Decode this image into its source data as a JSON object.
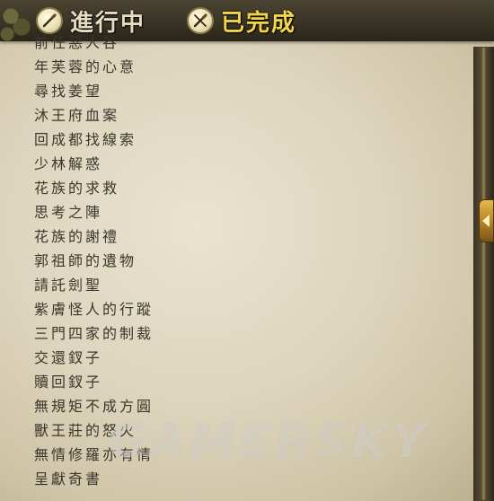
{
  "tabs": {
    "in_progress": {
      "label": "進行中",
      "icon": "brush-icon"
    },
    "completed": {
      "label": "已完成",
      "icon": "brush-crossed-icon"
    }
  },
  "quests": [
    "前任惡人谷",
    "年芙蓉的心意",
    "尋找姜望",
    "沐王府血案",
    "回成都找線索",
    "少林解惑",
    "花族的求救",
    "思考之陣",
    "花族的謝禮",
    "郭祖師的遺物",
    "請託劍聖",
    "紫膚怪人的行蹤",
    "三門四家的制裁",
    "交還釵子",
    "贖回釵子",
    "無規矩不成方圓",
    "獸王莊的怒火",
    "無情修羅亦有情",
    "呈獻奇書"
  ],
  "watermark": "GAMERSKY",
  "colors": {
    "active_tab": "#f2d64a",
    "inactive_tab": "#e6dcc0",
    "text": "#3a362c"
  }
}
